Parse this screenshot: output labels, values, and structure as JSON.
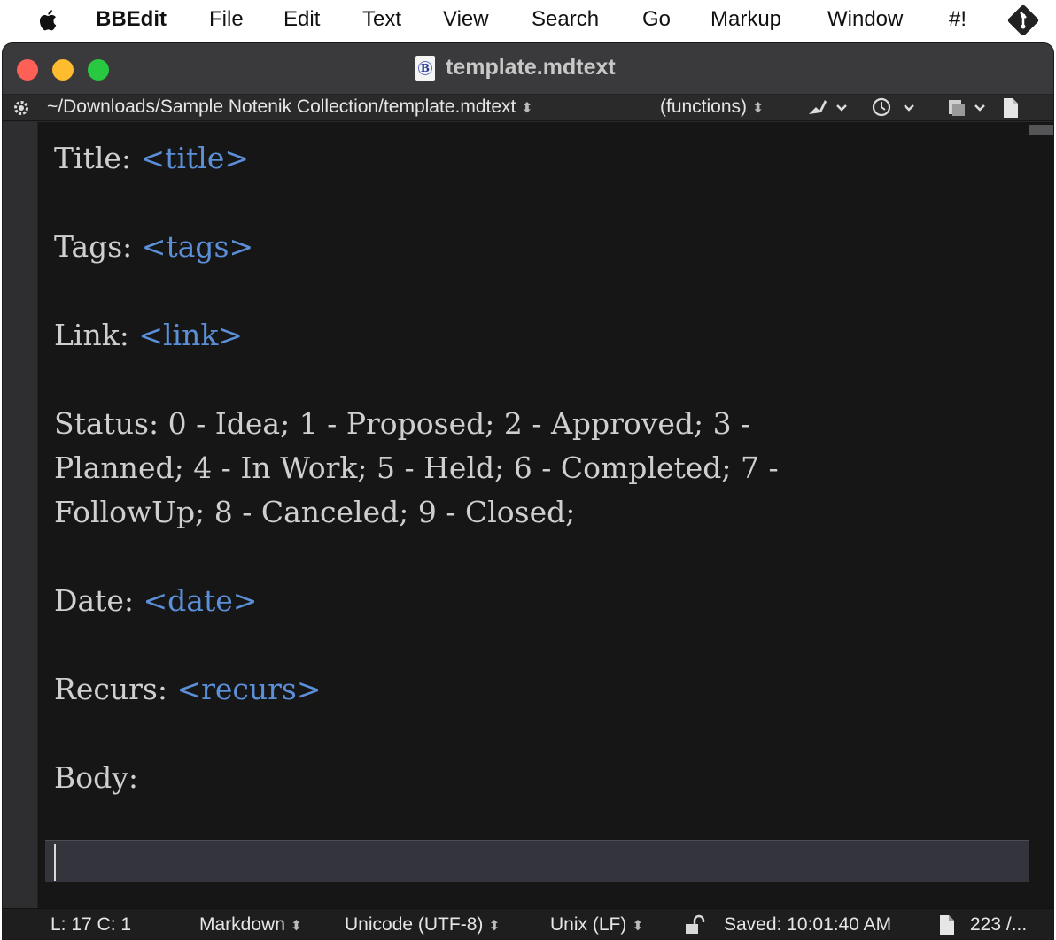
{
  "menubar": {
    "apple_icon": "apple-icon",
    "app_name": "BBEdit",
    "items": [
      "File",
      "Edit",
      "Text",
      "View",
      "Search",
      "Go",
      "Markup",
      "Window",
      "#!"
    ],
    "git_icon": "git-icon"
  },
  "window": {
    "title": "template.mdtext",
    "doc_icon_letter": "B"
  },
  "navbar": {
    "path": "~/Downloads/Sample Notenik Collection/template.mdtext",
    "functions": "(functions)"
  },
  "editor": {
    "lines": [
      {
        "label": "Title: ",
        "placeholder": "<title>"
      },
      {
        "label": "",
        "placeholder": ""
      },
      {
        "label": "Tags: ",
        "placeholder": "<tags>"
      },
      {
        "label": "",
        "placeholder": ""
      },
      {
        "label": "Link: ",
        "placeholder": "<link>"
      },
      {
        "label": "",
        "placeholder": ""
      },
      {
        "label": "Status: 0 - Idea; 1 - Proposed; 2 - Approved; 3 -",
        "placeholder": ""
      },
      {
        "label": "Planned; 4 - In Work; 5 - Held; 6 - Completed; 7 -",
        "placeholder": ""
      },
      {
        "label": "FollowUp; 8 - Canceled; 9 - Closed;",
        "placeholder": ""
      },
      {
        "label": "",
        "placeholder": ""
      },
      {
        "label": "Date: ",
        "placeholder": "<date>"
      },
      {
        "label": "",
        "placeholder": ""
      },
      {
        "label": "Recurs: ",
        "placeholder": "<recurs>"
      },
      {
        "label": "",
        "placeholder": ""
      },
      {
        "label": "Body:",
        "placeholder": ""
      }
    ]
  },
  "statusbar": {
    "position": "L: 17 C: 1",
    "language": "Markdown",
    "encoding": "Unicode (UTF-8)",
    "line_endings": "Unix (LF)",
    "saved": "Saved: 10:01:40 AM",
    "doc_stats": "223 /..."
  },
  "colors": {
    "placeholder": "#5b8fd8",
    "text": "#cfcfcf",
    "editor_bg": "#161616"
  }
}
